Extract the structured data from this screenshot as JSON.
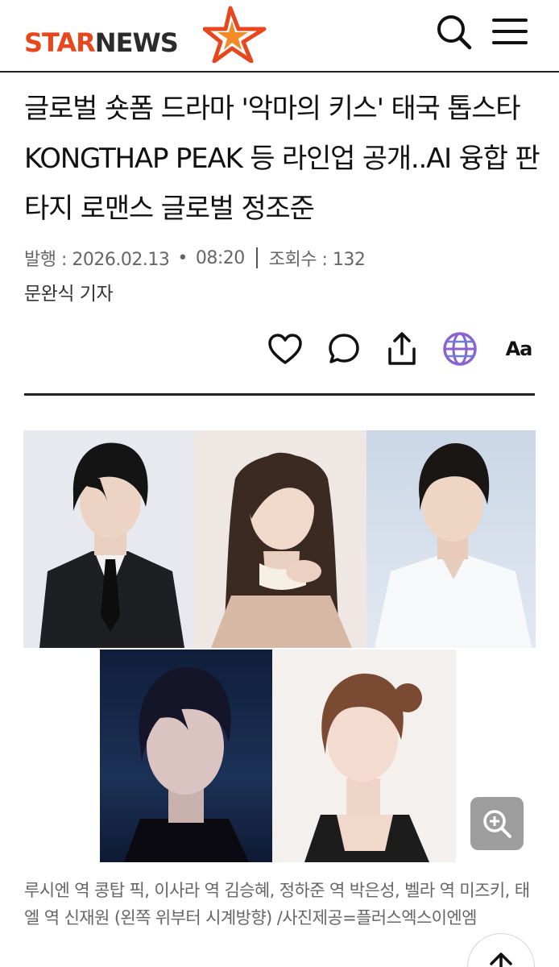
{
  "header": {
    "logo_star": "STAR",
    "logo_news": "NEWS",
    "search_icon": "search-icon",
    "menu_icon": "hamburger-menu-icon"
  },
  "article": {
    "title": "글로벌 숏폼 드라마 '악마의 키스' 태국 톱스타 KONGTHAP PEAK 등 라인업 공개..AI 융합 판타지 로맨스 글로벌 정조준",
    "published_label": "발행 : 2026.02.13",
    "published_time": "08:20",
    "views_label": "조회수 : 132",
    "reporter": "문완식 기자"
  },
  "actions": {
    "like_icon": "heart-icon",
    "comment_icon": "comment-icon",
    "share_icon": "share-icon",
    "translate_icon": "globe-icon",
    "font_size_label": "Aa"
  },
  "photo": {
    "caption": "루시엔 역 콩탑 픽, 이사라 역 김승혜, 정하준 역 박은성, 벨라 역 미즈키, 태엘 역 신재원 (왼쪽 위부터 시계방향) /사진제공=플러스엑스이엔엠",
    "zoom_icon": "zoom-in-icon"
  },
  "scroll_top_icon": "arrow-up-icon",
  "colors": {
    "brand_orange": "#e8471e",
    "text_dark": "#111111",
    "meta_gray": "#666666",
    "globe_purple": "#8a63d2"
  }
}
